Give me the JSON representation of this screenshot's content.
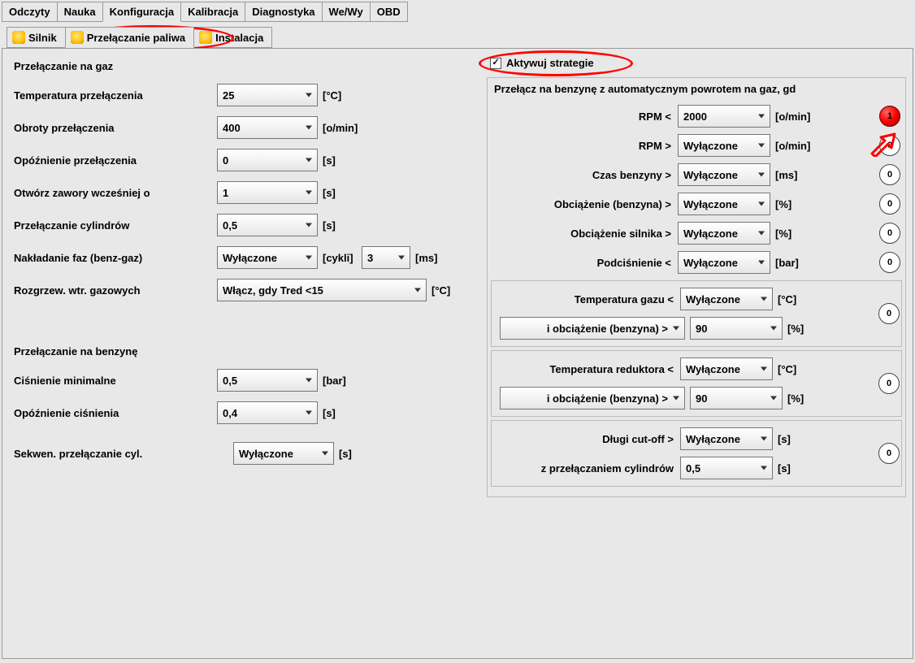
{
  "tabs": {
    "main": [
      "Odczyty",
      "Nauka",
      "Konfiguracja",
      "Kalibracja",
      "Diagnostyka",
      "We/Wy",
      "OBD"
    ],
    "main_active": 2,
    "sub": [
      "Silnik",
      "Przełączanie paliwa",
      "Instalacja"
    ],
    "sub_active": 1
  },
  "left": {
    "gas_title": "Przełączanie na gaz",
    "rows": {
      "temp": {
        "label": "Temperatura przełączenia",
        "value": "25",
        "unit": "[°C]"
      },
      "rpm": {
        "label": "Obroty przełączenia",
        "value": "400",
        "unit": "[o/min]"
      },
      "delay": {
        "label": "Opóźnienie przełączenia",
        "value": "0",
        "unit": "[s]"
      },
      "valves": {
        "label": "Otwórz zawory wcześniej o",
        "value": "1",
        "unit": "[s]"
      },
      "cyl": {
        "label": "Przełączanie cylindrów",
        "value": "0,5",
        "unit": "[s]"
      },
      "phase": {
        "label": "Nakładanie faz (benz-gaz)",
        "value": "Wyłączone",
        "unit1": "[cykli]",
        "value2": "3",
        "unit2": "[ms]"
      },
      "warmup": {
        "label": "Rozgrzew. wtr. gazowych",
        "value": "Włącz, gdy Tred <15",
        "unit": "[°C]"
      }
    },
    "petrol_title": "Przełączanie na benzynę",
    "rows2": {
      "pmin": {
        "label": "Ciśnienie minimalne",
        "value": "0,5",
        "unit": "[bar]"
      },
      "pdelay": {
        "label": "Opóźnienie ciśnienia",
        "value": "0,4",
        "unit": "[s]"
      },
      "seq": {
        "label": "Sekwen. przełączanie cyl.",
        "value": "Wyłączone",
        "unit": "[s]"
      }
    }
  },
  "right": {
    "activate_label": "Aktywuj strategie",
    "activate_checked": true,
    "title": "Przełącz na benzynę z automatycznym powrotem na gaz, gd",
    "rows": {
      "rpm_lt": {
        "label": "RPM <",
        "value": "2000",
        "unit": "[o/min]",
        "badge": "1",
        "badge_red": true
      },
      "rpm_gt": {
        "label": "RPM >",
        "value": "Wyłączone",
        "unit": "[o/min]",
        "badge": "0"
      },
      "t_benz": {
        "label": "Czas benzyny >",
        "value": "Wyłączone",
        "unit": "[ms]",
        "badge": "0"
      },
      "load_b": {
        "label": "Obciążenie (benzyna) >",
        "value": "Wyłączone",
        "unit": "[%]",
        "badge": "0"
      },
      "load_e": {
        "label": "Obciążenie silnika >",
        "value": "Wyłączone",
        "unit": "[%]",
        "badge": "0"
      },
      "vac": {
        "label": "Podciśnienie <",
        "value": "Wyłączone",
        "unit": "[bar]",
        "badge": "0"
      }
    },
    "pair1": {
      "label1": "Temperatura gazu <",
      "value1": "Wyłączone",
      "unit1": "[°C]",
      "label2_sel": "i obciążenie (benzyna) >",
      "value2": "90",
      "unit2": "[%]",
      "badge": "0"
    },
    "pair2": {
      "label1": "Temperatura reduktora <",
      "value1": "Wyłączone",
      "unit1": "[°C]",
      "label2_sel": "i obciążenie (benzyna) >",
      "value2": "90",
      "unit2": "[%]",
      "badge": "0"
    },
    "pair3": {
      "label1": "Długi cut-off >",
      "value1": "Wyłączone",
      "unit1": "[s]",
      "label2": "z przełączaniem cylindrów",
      "value2": "0,5",
      "unit2": "[s]",
      "badge": "0"
    }
  }
}
